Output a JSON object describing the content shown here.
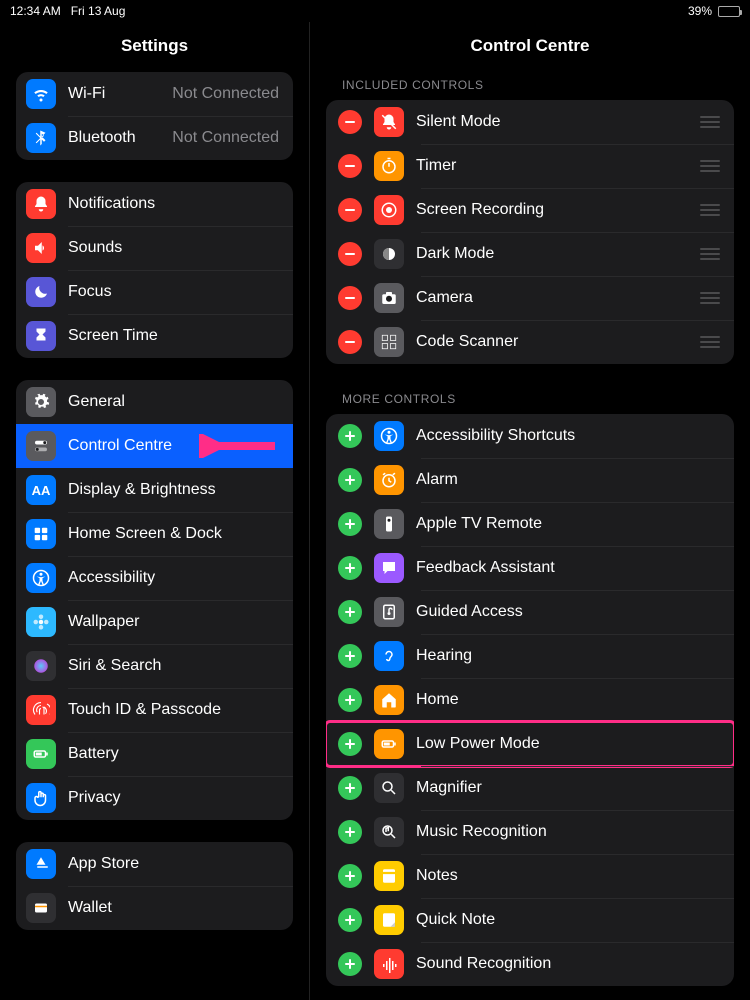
{
  "statusbar": {
    "time": "12:34 AM",
    "date": "Fri 13 Aug",
    "battery_pct": "39%"
  },
  "sidebar": {
    "title": "Settings",
    "groups": [
      [
        {
          "label": "Wi-Fi",
          "value": "Not Connected",
          "icon": "wifi",
          "color": "c-blue"
        },
        {
          "label": "Bluetooth",
          "value": "Not Connected",
          "icon": "bluetooth",
          "color": "c-blue"
        }
      ],
      [
        {
          "label": "Notifications",
          "icon": "bell",
          "color": "c-red"
        },
        {
          "label": "Sounds",
          "icon": "speaker",
          "color": "c-red"
        },
        {
          "label": "Focus",
          "icon": "moon",
          "color": "c-indigo"
        },
        {
          "label": "Screen Time",
          "icon": "hourglass",
          "color": "c-indigo"
        }
      ],
      [
        {
          "label": "General",
          "icon": "gear",
          "color": "c-gray"
        },
        {
          "label": "Control Centre",
          "icon": "toggles",
          "color": "c-gray",
          "selected": true
        },
        {
          "label": "Display & Brightness",
          "icon": "AA",
          "color": "c-blue"
        },
        {
          "label": "Home Screen & Dock",
          "icon": "grid",
          "color": "c-blue"
        },
        {
          "label": "Accessibility",
          "icon": "accessibility",
          "color": "c-blue"
        },
        {
          "label": "Wallpaper",
          "icon": "flower",
          "color": "c-cyan"
        },
        {
          "label": "Siri & Search",
          "icon": "siri",
          "color": "c-dark"
        },
        {
          "label": "Touch ID & Passcode",
          "icon": "fingerprint",
          "color": "c-red"
        },
        {
          "label": "Battery",
          "icon": "battery",
          "color": "c-green"
        },
        {
          "label": "Privacy",
          "icon": "hand",
          "color": "c-blue"
        }
      ],
      [
        {
          "label": "App Store",
          "icon": "appstore",
          "color": "c-blue"
        },
        {
          "label": "Wallet",
          "icon": "wallet",
          "color": "c-dark"
        }
      ]
    ]
  },
  "detail": {
    "title": "Control Centre",
    "sections": [
      {
        "label": "INCLUDED CONTROLS",
        "mode": "remove",
        "items": [
          {
            "label": "Silent Mode",
            "icon": "bell-slash",
            "color": "c-red"
          },
          {
            "label": "Timer",
            "icon": "timer",
            "color": "c-orange"
          },
          {
            "label": "Screen Recording",
            "icon": "record",
            "color": "c-red"
          },
          {
            "label": "Dark Mode",
            "icon": "darkmode",
            "color": "c-dark"
          },
          {
            "label": "Camera",
            "icon": "camera",
            "color": "c-gray"
          },
          {
            "label": "Code Scanner",
            "icon": "qrscan",
            "color": "c-gray"
          }
        ]
      },
      {
        "label": "MORE CONTROLS",
        "mode": "add",
        "items": [
          {
            "label": "Accessibility Shortcuts",
            "icon": "accessibility",
            "color": "c-blue"
          },
          {
            "label": "Alarm",
            "icon": "alarm",
            "color": "c-orange"
          },
          {
            "label": "Apple TV Remote",
            "icon": "remote",
            "color": "c-gray"
          },
          {
            "label": "Feedback Assistant",
            "icon": "feedback",
            "color": "c-purple"
          },
          {
            "label": "Guided Access",
            "icon": "guided",
            "color": "c-gray"
          },
          {
            "label": "Hearing",
            "icon": "ear",
            "color": "c-blue"
          },
          {
            "label": "Home",
            "icon": "home",
            "color": "c-orange"
          },
          {
            "label": "Low Power Mode",
            "icon": "battery",
            "color": "c-orange",
            "highlighted": true
          },
          {
            "label": "Magnifier",
            "icon": "magnify",
            "color": "c-dark"
          },
          {
            "label": "Music Recognition",
            "icon": "music-rec",
            "color": "c-dark"
          },
          {
            "label": "Notes",
            "icon": "notes",
            "color": "c-yellow"
          },
          {
            "label": "Quick Note",
            "icon": "quicknote",
            "color": "c-yellow"
          },
          {
            "label": "Sound Recognition",
            "icon": "sound-rec",
            "color": "c-red"
          }
        ]
      }
    ]
  },
  "annotations": {
    "arrow_target": "Control Centre",
    "highlight_target": "Low Power Mode"
  }
}
